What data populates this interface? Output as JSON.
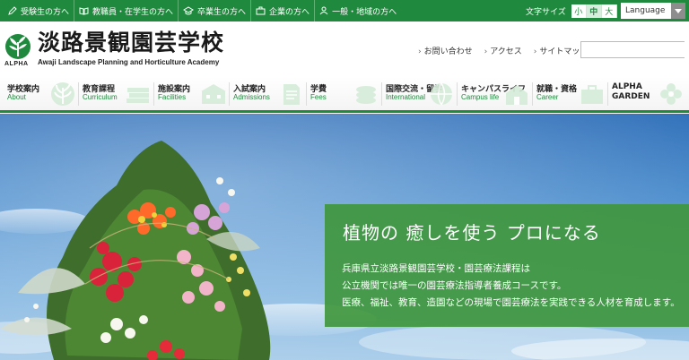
{
  "topbar": {
    "nav": [
      {
        "label": "受験生の方へ",
        "icon": "pencil-icon"
      },
      {
        "label": "教職員・在学生の方へ",
        "icon": "book-icon"
      },
      {
        "label": "卒業生の方へ",
        "icon": "graduation-cap-icon"
      },
      {
        "label": "企業の方へ",
        "icon": "briefcase-icon"
      },
      {
        "label": "一般・地域の方へ",
        "icon": "person-icon"
      }
    ],
    "font_size_label": "文字サイズ",
    "font_sizes": [
      "小",
      "中",
      "大"
    ],
    "font_size_selected": "中",
    "language_label": "Language"
  },
  "header": {
    "logo_text": "ALPHA",
    "title": "淡路景観園芸学校",
    "subtitle": "Awaji Landscape Planning and Horticulture Academy",
    "util_links": [
      "お問い合わせ",
      "アクセス",
      "サイトマップ"
    ],
    "search_placeholder": ""
  },
  "gnav": [
    {
      "jp": "学校案内",
      "en": "About"
    },
    {
      "jp": "教育課程",
      "en": "Curriculum"
    },
    {
      "jp": "施設案内",
      "en": "Facilities"
    },
    {
      "jp": "入試案内",
      "en": "Admissions"
    },
    {
      "jp": "学費",
      "en": "Fees"
    },
    {
      "jp": "国際交流・留学",
      "en": "International"
    },
    {
      "jp": "キャンパスライフ",
      "en": "Campus life"
    },
    {
      "jp": "就職・資格",
      "en": "Career"
    },
    {
      "jp": "ALPHA",
      "en": "GARDEN"
    }
  ],
  "hero": {
    "catch": "植物の 癒しを使う プロになる",
    "lines": [
      "兵庫県立淡路景観園芸学校・園芸療法課程は",
      "公立機関では唯一の園芸療法指導者養成コースです。",
      "医療、福祉、教育、造園などの現場で園芸療法を実践できる人材を育成します。"
    ]
  },
  "colors": {
    "brand_green": "#1f8a3e",
    "panel_green": "#3e963a",
    "sky": "#4b8dcd"
  }
}
